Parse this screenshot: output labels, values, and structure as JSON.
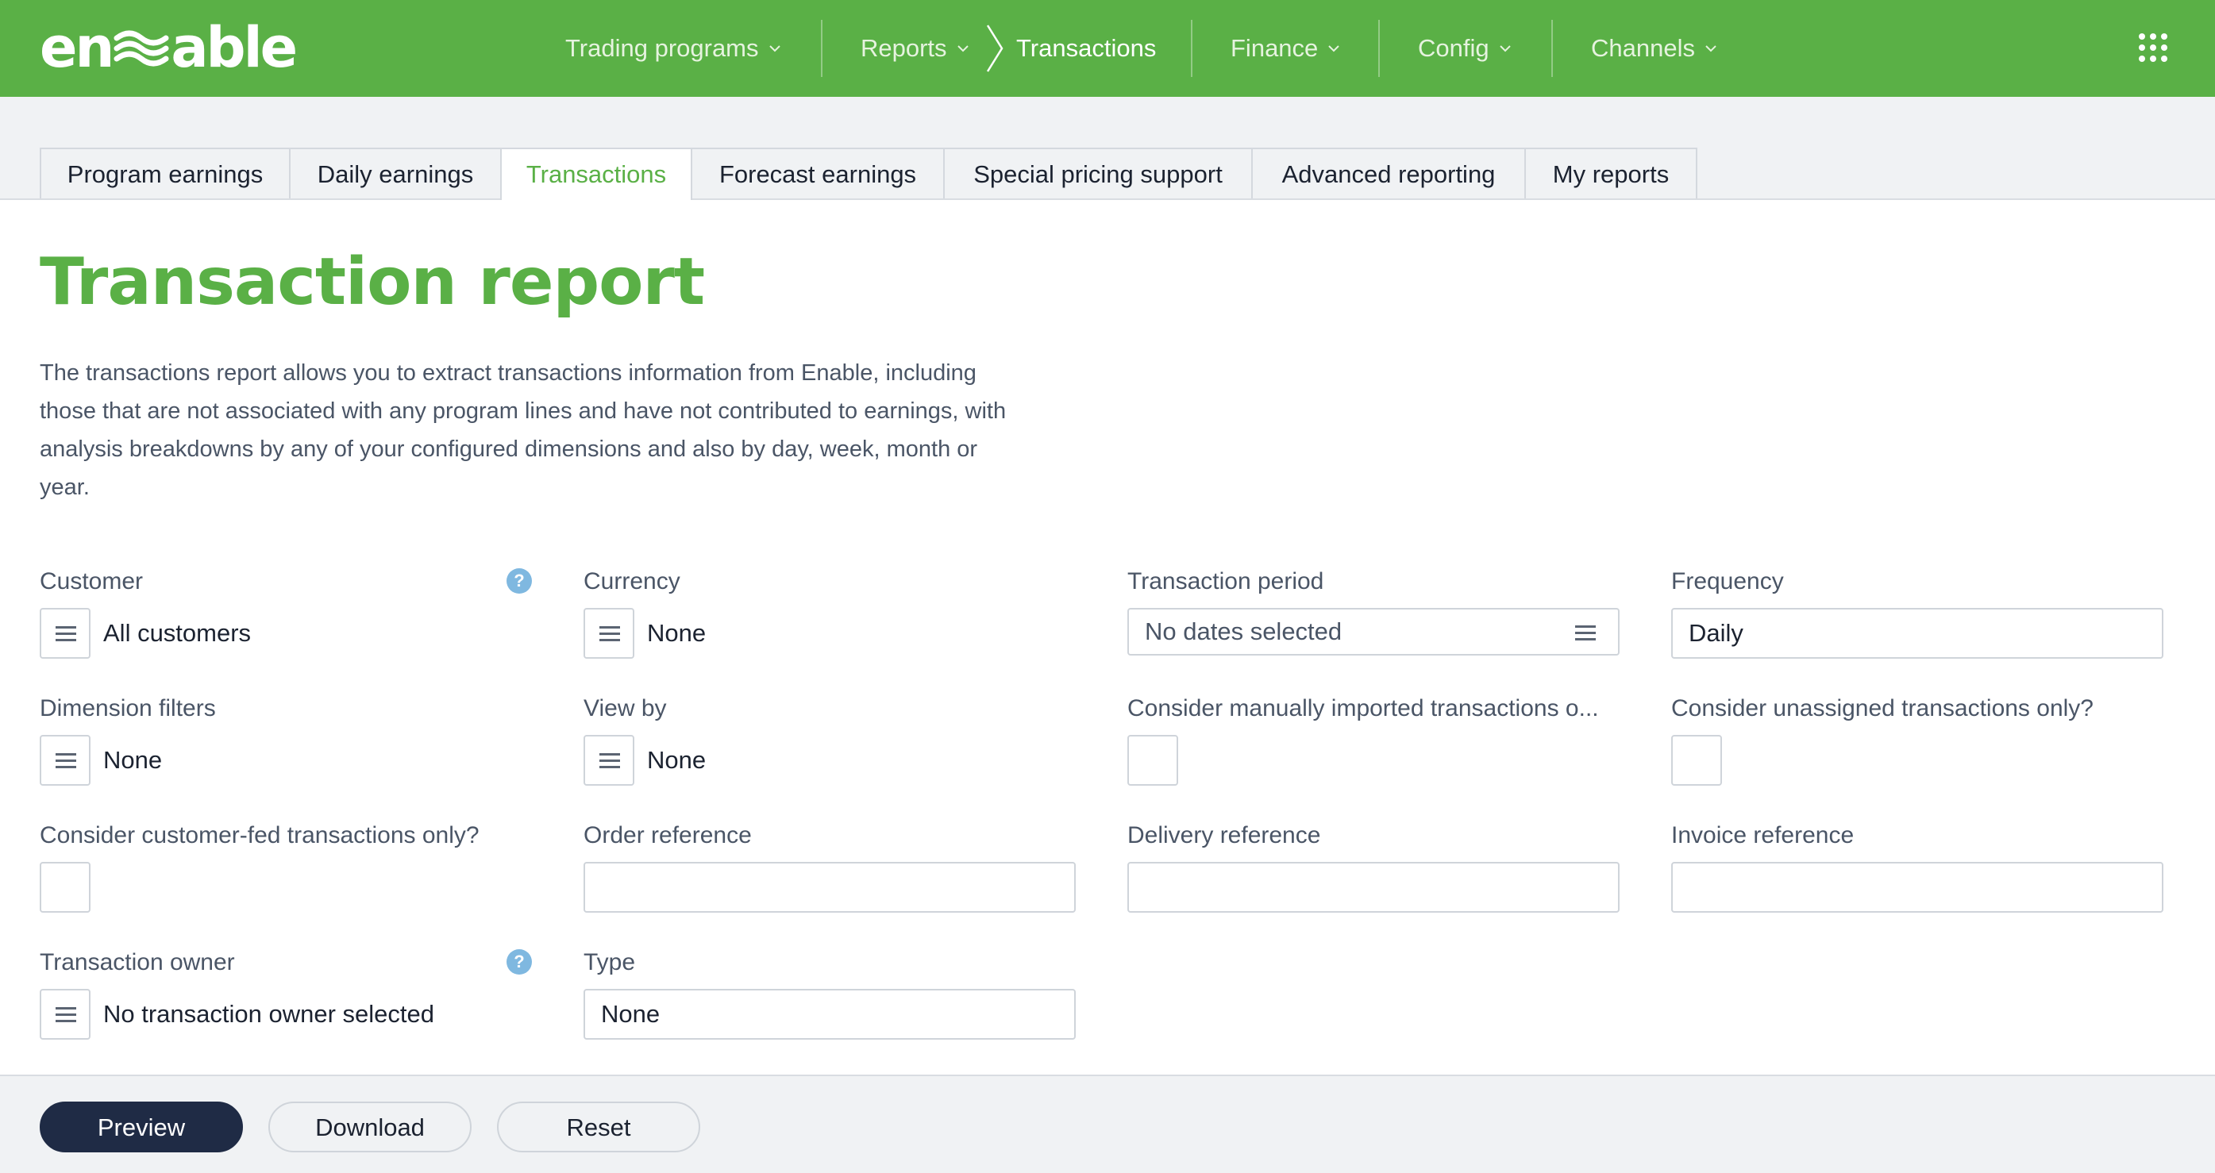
{
  "colors": {
    "brand_green": "#5ab046",
    "primary_button": "#1f2b45",
    "help_blue": "#7fb8e0"
  },
  "header": {
    "logo_left": "en",
    "logo_right": "able",
    "nav": [
      {
        "label": "Trading programs",
        "has_dropdown": true
      },
      {
        "label": "Reports",
        "has_dropdown": true
      },
      {
        "label": "Transactions",
        "has_dropdown": false,
        "active": true
      },
      {
        "label": "Finance",
        "has_dropdown": true
      },
      {
        "label": "Config",
        "has_dropdown": true
      },
      {
        "label": "Channels",
        "has_dropdown": true
      }
    ],
    "apps_icon": "grid-apps-icon"
  },
  "tabs": [
    {
      "label": "Program earnings"
    },
    {
      "label": "Daily earnings"
    },
    {
      "label": "Transactions",
      "active": true
    },
    {
      "label": "Forecast earnings"
    },
    {
      "label": "Special pricing support"
    },
    {
      "label": "Advanced reporting"
    },
    {
      "label": "My reports"
    }
  ],
  "page": {
    "title": "Transaction report",
    "description": "The transactions report allows you to extract transactions information from Enable, including those that are not associated with any program lines and have not contributed to earnings, with analysis breakdowns by any of your configured dimensions and also by day, week, month or year."
  },
  "form": {
    "customer": {
      "label": "Customer",
      "value": "All customers",
      "help": "?"
    },
    "currency": {
      "label": "Currency",
      "value": "None"
    },
    "transaction_period": {
      "label": "Transaction period",
      "value": "No dates selected"
    },
    "frequency": {
      "label": "Frequency",
      "value": "Daily"
    },
    "dimension_filters": {
      "label": "Dimension filters",
      "value": "None"
    },
    "view_by": {
      "label": "View by",
      "value": "None"
    },
    "manual_imported": {
      "label": "Consider manually imported transactions o...",
      "checked": false
    },
    "unassigned_only": {
      "label": "Consider unassigned transactions only?",
      "checked": false
    },
    "customer_fed_only": {
      "label": "Consider customer-fed transactions only?",
      "checked": false
    },
    "order_reference": {
      "label": "Order reference",
      "value": ""
    },
    "delivery_reference": {
      "label": "Delivery reference",
      "value": ""
    },
    "invoice_reference": {
      "label": "Invoice reference",
      "value": ""
    },
    "transaction_owner": {
      "label": "Transaction owner",
      "value": "No transaction owner selected",
      "help": "?"
    },
    "type": {
      "label": "Type",
      "value": "None"
    }
  },
  "footer": {
    "preview_label": "Preview",
    "download_label": "Download",
    "reset_label": "Reset"
  }
}
